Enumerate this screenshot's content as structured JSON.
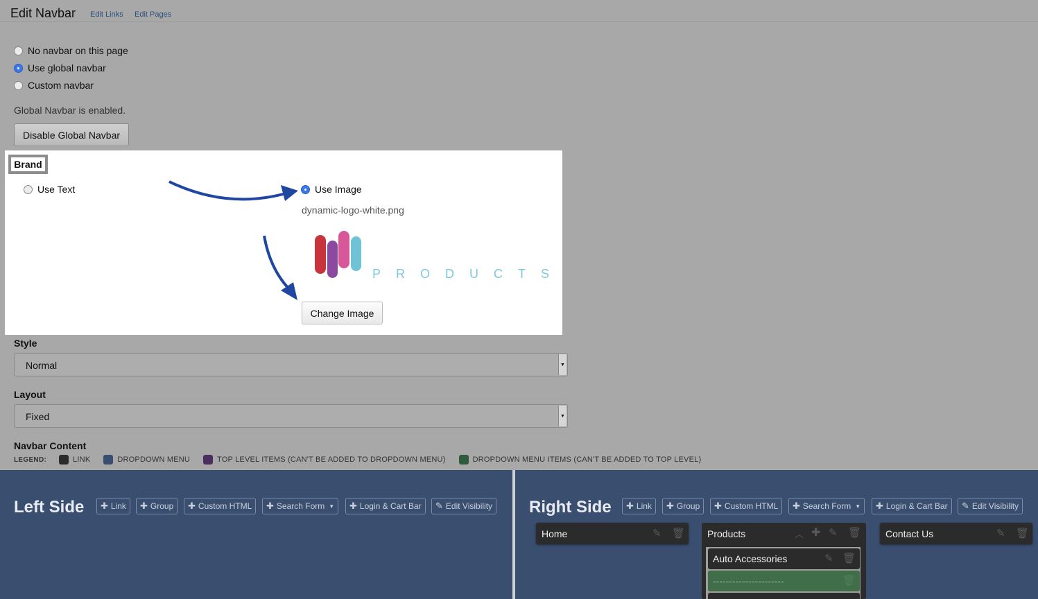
{
  "header": {
    "title": "Edit Navbar",
    "links": [
      "Edit Links",
      "Edit Pages"
    ]
  },
  "navbar_mode": {
    "options": [
      "No navbar on this page",
      "Use global navbar",
      "Custom navbar"
    ],
    "selected": "Use global navbar"
  },
  "status_text": "Global Navbar is enabled.",
  "disable_button": "Disable Global Navbar",
  "brand": {
    "label": "Brand",
    "use_text": "Use Text",
    "use_image": "Use Image",
    "selected": "Use Image",
    "filename": "dynamic-logo-white.png",
    "logo_text": "PRODUCTS",
    "change_button": "Change Image",
    "arrow_color": "#1f46a0"
  },
  "style": {
    "label": "Style",
    "value": "Normal"
  },
  "layout": {
    "label": "Layout",
    "value": "Fixed"
  },
  "navbar_content": {
    "label": "Navbar Content",
    "legend_title": "LEGEND:",
    "legend": [
      {
        "label": "LINK",
        "color": "#2b2b2b"
      },
      {
        "label": "DROPDOWN MENU",
        "color": "#3a4f70"
      },
      {
        "label": "TOP LEVEL ITEMS (CAN'T BE ADDED TO DROPDOWN MENU)",
        "color": "#4a2f5e"
      },
      {
        "label": "DROPDOWN MENU ITEMS (CAN'T BE ADDED TO TOP LEVEL)",
        "color": "#2f5a3c"
      }
    ]
  },
  "toolbar": [
    "Link",
    "Group",
    "Custom HTML",
    "Search Form",
    "Login & Cart Bar",
    "Edit Visibility"
  ],
  "left_side": {
    "title": "Left Side"
  },
  "right_side": {
    "title": "Right Side",
    "items": [
      "Home",
      "Products",
      "Contact Us"
    ],
    "products_children": [
      "Auto Accessories",
      "----------------------"
    ]
  },
  "colors": {
    "page_bg": "#a8a8a8",
    "panel_bg": "#3a4f70",
    "link_item": "#2b2b2b",
    "divider_item": "#3f6e48",
    "radio_accent": "#3b78e7"
  }
}
